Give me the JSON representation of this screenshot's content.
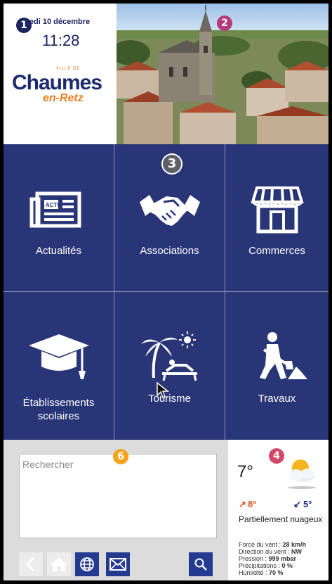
{
  "header": {
    "date": "'redi 10 décembre",
    "time": "11:28",
    "logo": {
      "small": "VILLE DE",
      "main": "Chaumes",
      "sub": "en-Retz"
    },
    "photo_icon": "church-aerial-photo"
  },
  "markers": [
    "1",
    "2",
    "3",
    "4",
    "6"
  ],
  "tiles": [
    {
      "label": "Actualités",
      "icon": "newspaper-icon",
      "icon_text": "ACTU"
    },
    {
      "label": "Associations",
      "icon": "handshake-icon"
    },
    {
      "label": "Commerces",
      "icon": "storefront-icon"
    },
    {
      "label": "Établissements scolaires",
      "icon": "graduation-cap-icon"
    },
    {
      "label": "Tourisme",
      "icon": "palm-beach-icon"
    },
    {
      "label": "Travaux",
      "icon": "roadwork-icon"
    }
  ],
  "search": {
    "placeholder": "Rechercher"
  },
  "toolbar": {
    "buttons": [
      "back-icon",
      "home-icon",
      "globe-icon",
      "mail-icon",
      "search-icon"
    ]
  },
  "weather": {
    "temp": "7°",
    "icon": "partly-cloudy-icon",
    "min_arrow": "↗",
    "min": "8°",
    "max_arrow": "↙",
    "max": "5°",
    "condition": "Partiellement nuageux",
    "details": [
      {
        "label": "Force du vent : ",
        "value": "28 km/h"
      },
      {
        "label": "Direction du vent : ",
        "value": "NW"
      },
      {
        "label": "Pression : ",
        "value": "999 mbar"
      },
      {
        "label": "Précipitations : ",
        "value": "0 %"
      },
      {
        "label": "Humidité : ",
        "value": "70 %"
      }
    ]
  },
  "colors": {
    "grid_bg": "#283577",
    "accent_orange": "#ee7d21",
    "toolbar_blue": "#233a8f"
  }
}
